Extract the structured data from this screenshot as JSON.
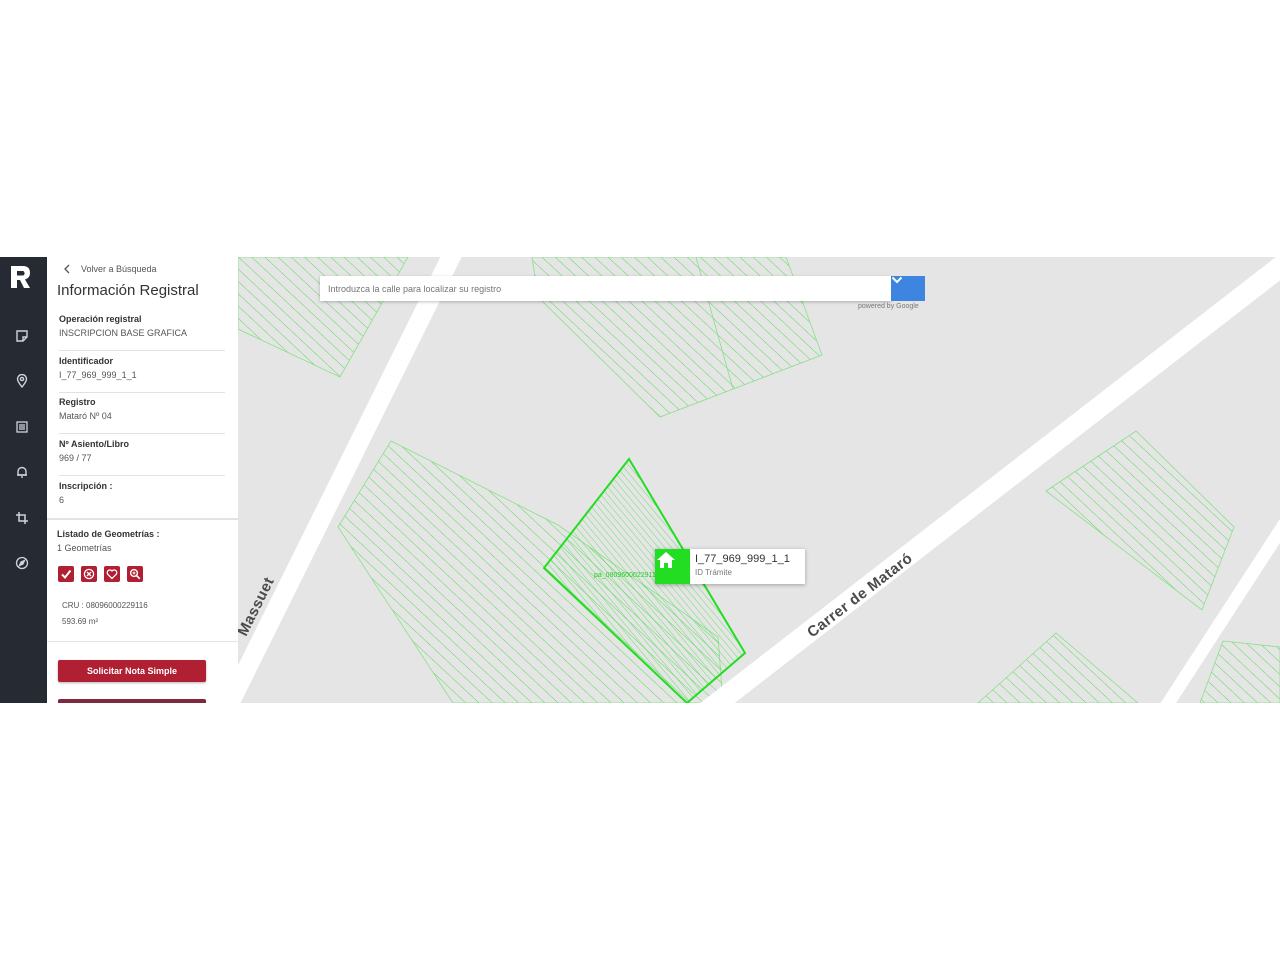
{
  "nav": {
    "icons": [
      "note-icon",
      "location-pin-icon",
      "list-icon",
      "bell-icon",
      "crop-icon",
      "compass-icon"
    ]
  },
  "panel": {
    "back_label": "Volver a Búsqueda",
    "title": "Información Registral",
    "fields": [
      {
        "label": "Operación registral",
        "value": "INSCRIPCION BASE GRAFICA"
      },
      {
        "label": "Identificador",
        "value": "I_77_969_999_1_1"
      },
      {
        "label": "Registro",
        "value": "Mataró Nº 04"
      },
      {
        "label": "Nº Asiento/Libro",
        "value": "969 / 77"
      },
      {
        "label": "Inscripción :",
        "value": "6"
      }
    ],
    "geometries": {
      "title": "Listado de Geometrías :",
      "count": "1 Geometrías",
      "cru": "CRU : 08096000229116",
      "area": "593.69 m²"
    },
    "request_button": "Solicitar Nota Simple"
  },
  "map": {
    "search_placeholder": "Introduzca la calle para localizar su registro",
    "powered_by": "powered by Google",
    "streets": {
      "left": "Massuet",
      "right": "Carrer de Mataró"
    },
    "parcel_label": "pa_08096000229116",
    "popup": {
      "id": "I_77_969_999_1_1",
      "subtitle": "ID Trámite"
    },
    "colors": {
      "background": "#e5e5e5",
      "street": "#ffffff",
      "parcel": "#22dd22",
      "accent": "#b01f32"
    }
  }
}
